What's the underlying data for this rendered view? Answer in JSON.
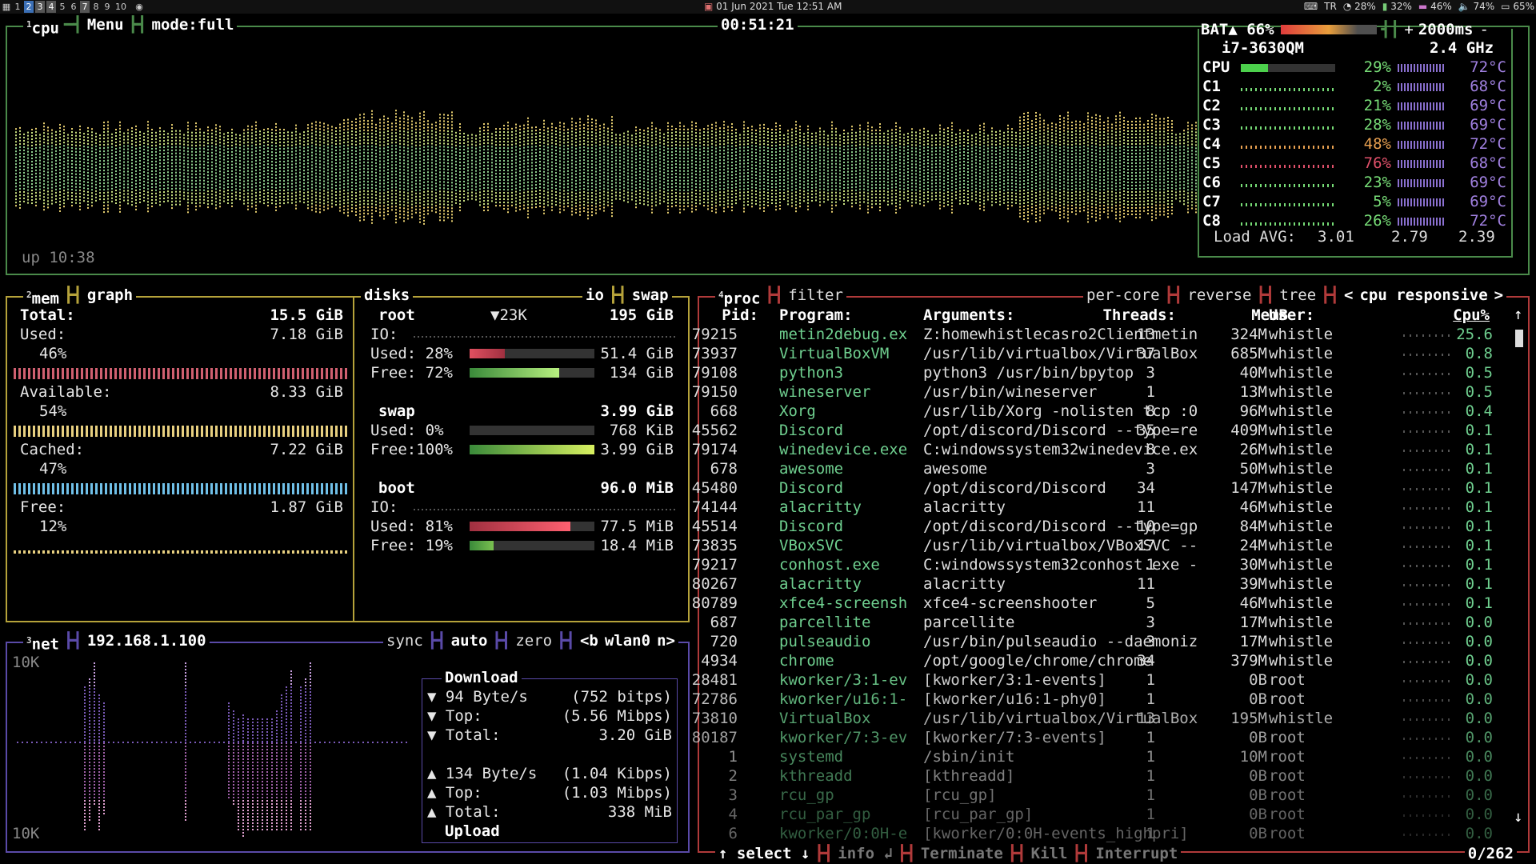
{
  "topbar": {
    "workspaces": [
      "1",
      "2",
      "3",
      "4",
      "5",
      "6",
      "7",
      "8",
      "9",
      "10"
    ],
    "workspace_active": "2",
    "clock": "01 Jun 2021 Tue 12:51 AM",
    "tray": [
      "TR",
      "28%",
      "32%",
      "46%",
      "74%",
      "65%"
    ]
  },
  "cpu": {
    "title_num": "1",
    "title": "cpu",
    "menu": "Menu",
    "mode": "mode:full",
    "time": "00:51:21",
    "battery": "BAT▲ 66%",
    "interval_plus": "+",
    "interval": "2000ms",
    "interval_minus": "-",
    "model": "i7-3630QM",
    "freq": "2.4 GHz",
    "uptime": "up 10:38",
    "cores": [
      {
        "name": "CPU",
        "pct": "29%",
        "temp": "72°C",
        "value": 29
      },
      {
        "name": "C1",
        "pct": "2%",
        "temp": "68°C",
        "value": 2
      },
      {
        "name": "C2",
        "pct": "21%",
        "temp": "69°C",
        "value": 21
      },
      {
        "name": "C3",
        "pct": "28%",
        "temp": "69°C",
        "value": 28
      },
      {
        "name": "C4",
        "pct": "48%",
        "temp": "72°C",
        "value": 48
      },
      {
        "name": "C5",
        "pct": "76%",
        "temp": "68°C",
        "value": 76
      },
      {
        "name": "C6",
        "pct": "23%",
        "temp": "69°C",
        "value": 23
      },
      {
        "name": "C7",
        "pct": "5%",
        "temp": "69°C",
        "value": 5
      },
      {
        "name": "C8",
        "pct": "26%",
        "temp": "72°C",
        "value": 26
      }
    ],
    "load_label": "Load AVG:",
    "load": [
      "3.01",
      "2.79",
      "2.39"
    ]
  },
  "mem": {
    "title_num": "2",
    "title": "mem",
    "graph": "graph",
    "total_label": "Total:",
    "total": "15.5 GiB",
    "used_label": "Used:",
    "used": "7.18 GiB",
    "used_pct": "46%",
    "avail_label": "Available:",
    "avail": "8.33 GiB",
    "avail_pct": "54%",
    "cached_label": "Cached:",
    "cached": "7.22 GiB",
    "cached_pct": "47%",
    "free_label": "Free:",
    "free": "1.87 GiB",
    "free_pct": "12%"
  },
  "disks": {
    "title": "disks",
    "io": "io",
    "swap_tab": "swap",
    "root": {
      "name": "root",
      "io_rate": "▼23K",
      "size": "195 GiB",
      "io_label": "IO:",
      "used_label": "Used: 28%",
      "used": "51.4 GiB",
      "free_label": "Free: 72%",
      "free": "134 GiB",
      "used_value": 28,
      "free_value": 72
    },
    "swap": {
      "name": "swap",
      "size": "3.99 GiB",
      "used_label": "Used:  0%",
      "used": "768 KiB",
      "free_label": "Free:100%",
      "free": "3.99 GiB",
      "used_value": 0,
      "free_value": 100
    },
    "boot": {
      "name": "boot",
      "size": "96.0 MiB",
      "io_label": "IO:",
      "used_label": "Used: 81%",
      "used": "77.5 MiB",
      "free_label": "Free: 19%",
      "free": "18.4 MiB",
      "used_value": 81,
      "free_value": 19
    }
  },
  "net": {
    "title_num": "3",
    "title": "net",
    "ip": "192.168.1.100",
    "sync": "sync",
    "auto": "auto",
    "zero": "zero",
    "prev": "<b",
    "iface": "wlan0",
    "next": "n>",
    "scale_top": "10K",
    "scale_bottom": "10K",
    "download": "Download",
    "dl_rate": "▼ 94 Byte/s",
    "dl_bits": "(752 bitps)",
    "dl_top_label": "▼ Top:",
    "dl_top": "(5.56 Mibps)",
    "dl_total_label": "▼ Total:",
    "dl_total": "3.20 GiB",
    "ul_rate": "▲ 134 Byte/s",
    "ul_bits": "(1.04 Kibps)",
    "ul_top_label": "▲ Top:",
    "ul_top": "(1.03 Mibps)",
    "ul_total_label": "▲ Total:",
    "ul_total": "338 MiB",
    "upload": "Upload"
  },
  "proc": {
    "title_num": "4",
    "title": "proc",
    "filter": "filter",
    "percore": "per-core",
    "reverse": "reverse",
    "tree": "tree",
    "sort_prev": "<",
    "sort": "cpu responsive",
    "sort_next": ">",
    "headers": {
      "pid": "Pid:",
      "program": "Program:",
      "args": "Arguments:",
      "threads": "Threads:",
      "user": "User:",
      "mem": "MemB",
      "cpu": "Cpu%"
    },
    "rows": [
      {
        "pid": "79215",
        "program": "metin2debug.ex",
        "args": "Z:homewhistlecasro2Clientmetin",
        "threads": "13",
        "user": "whistle",
        "mem": "324M",
        "cpu": "25.6"
      },
      {
        "pid": "73937",
        "program": "VirtualBoxVM",
        "args": "/usr/lib/virtualbox/VirtualBox",
        "threads": "37",
        "user": "whistle",
        "mem": "685M",
        "cpu": "0.8"
      },
      {
        "pid": "79108",
        "program": "python3",
        "args": "python3 /usr/bin/bpytop",
        "threads": "3",
        "user": "whistle",
        "mem": "40M",
        "cpu": "0.5"
      },
      {
        "pid": "79150",
        "program": "wineserver",
        "args": "/usr/bin/wineserver",
        "threads": "1",
        "user": "whistle",
        "mem": "13M",
        "cpu": "0.5"
      },
      {
        "pid": "668",
        "program": "Xorg",
        "args": "/usr/lib/Xorg -nolisten tcp :0",
        "threads": "8",
        "user": "whistle",
        "mem": "96M",
        "cpu": "0.4"
      },
      {
        "pid": "45562",
        "program": "Discord",
        "args": "/opt/discord/Discord --type=re",
        "threads": "35",
        "user": "whistle",
        "mem": "409M",
        "cpu": "0.1"
      },
      {
        "pid": "79174",
        "program": "winedevice.exe",
        "args": "C:windowssystem32winedevice.ex",
        "threads": "8",
        "user": "whistle",
        "mem": "26M",
        "cpu": "0.1"
      },
      {
        "pid": "678",
        "program": "awesome",
        "args": "awesome",
        "threads": "3",
        "user": "whistle",
        "mem": "50M",
        "cpu": "0.1"
      },
      {
        "pid": "45480",
        "program": "Discord",
        "args": "/opt/discord/Discord",
        "threads": "34",
        "user": "whistle",
        "mem": "147M",
        "cpu": "0.1"
      },
      {
        "pid": "74144",
        "program": "alacritty",
        "args": "alacritty",
        "threads": "11",
        "user": "whistle",
        "mem": "46M",
        "cpu": "0.1"
      },
      {
        "pid": "45514",
        "program": "Discord",
        "args": "/opt/discord/Discord --type=gp",
        "threads": "10",
        "user": "whistle",
        "mem": "84M",
        "cpu": "0.1"
      },
      {
        "pid": "73835",
        "program": "VBoxSVC",
        "args": "/usr/lib/virtualbox/VBoxSVC --",
        "threads": "17",
        "user": "whistle",
        "mem": "24M",
        "cpu": "0.1"
      },
      {
        "pid": "79217",
        "program": "conhost.exe",
        "args": "C:windowssystem32conhost.exe -",
        "threads": "1",
        "user": "whistle",
        "mem": "30M",
        "cpu": "0.1"
      },
      {
        "pid": "80267",
        "program": "alacritty",
        "args": "alacritty",
        "threads": "11",
        "user": "whistle",
        "mem": "39M",
        "cpu": "0.1"
      },
      {
        "pid": "80789",
        "program": "xfce4-screensh",
        "args": "xfce4-screenshooter",
        "threads": "5",
        "user": "whistle",
        "mem": "46M",
        "cpu": "0.1"
      },
      {
        "pid": "687",
        "program": "parcellite",
        "args": "parcellite",
        "threads": "3",
        "user": "whistle",
        "mem": "17M",
        "cpu": "0.0"
      },
      {
        "pid": "720",
        "program": "pulseaudio",
        "args": "/usr/bin/pulseaudio --daemoniz",
        "threads": "3",
        "user": "whistle",
        "mem": "17M",
        "cpu": "0.0"
      },
      {
        "pid": "4934",
        "program": "chrome",
        "args": "/opt/google/chrome/chrome",
        "threads": "34",
        "user": "whistle",
        "mem": "379M",
        "cpu": "0.0"
      },
      {
        "pid": "28481",
        "program": "kworker/3:1-ev",
        "args": "[kworker/3:1-events]",
        "threads": "1",
        "user": "root",
        "mem": "0B",
        "cpu": "0.0"
      },
      {
        "pid": "72786",
        "program": "kworker/u16:1-",
        "args": "[kworker/u16:1-phy0]",
        "threads": "1",
        "user": "root",
        "mem": "0B",
        "cpu": "0.0"
      },
      {
        "pid": "73810",
        "program": "VirtualBox",
        "args": "/usr/lib/virtualbox/VirtualBox",
        "threads": "13",
        "user": "whistle",
        "mem": "195M",
        "cpu": "0.0"
      },
      {
        "pid": "80187",
        "program": "kworker/7:3-ev",
        "args": "[kworker/7:3-events]",
        "threads": "1",
        "user": "root",
        "mem": "0B",
        "cpu": "0.0"
      },
      {
        "pid": "1",
        "program": "systemd",
        "args": "/sbin/init",
        "threads": "1",
        "user": "root",
        "mem": "10M",
        "cpu": "0.0"
      },
      {
        "pid": "2",
        "program": "kthreadd",
        "args": "[kthreadd]",
        "threads": "1",
        "user": "root",
        "mem": "0B",
        "cpu": "0.0"
      },
      {
        "pid": "3",
        "program": "rcu_gp",
        "args": "[rcu_gp]",
        "threads": "1",
        "user": "root",
        "mem": "0B",
        "cpu": "0.0"
      },
      {
        "pid": "4",
        "program": "rcu_par_gp",
        "args": "[rcu_par_gp]",
        "threads": "1",
        "user": "root",
        "mem": "0B",
        "cpu": "0.0"
      },
      {
        "pid": "6",
        "program": "kworker/0:0H-e",
        "args": "[kworker/0:0H-events_highpri]",
        "threads": "1",
        "user": "root",
        "mem": "0B",
        "cpu": "0.0"
      }
    ],
    "footer": {
      "select": "↑ select ↓",
      "info": "info ↲",
      "terminate": "Terminate",
      "kill": "Kill",
      "interrupt": "Interrupt",
      "count": "0/262"
    },
    "scroll_up": "↑",
    "scroll_down": "↓"
  },
  "colors": {
    "cpu_border": "#4a8a4a",
    "mem_border": "#b5a23a",
    "net_border": "#5a4aa8",
    "proc_border": "#b03a3a",
    "accent_green": "#77dd77",
    "accent_red": "#e0506a",
    "program_green": "#6fcf8f",
    "temp_purple": "#a080e0"
  }
}
